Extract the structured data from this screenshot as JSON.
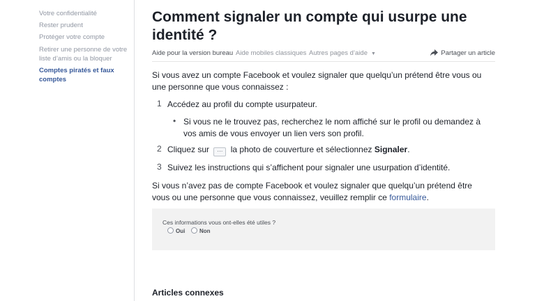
{
  "sidebar": {
    "items": [
      {
        "label": "Votre confidentialité",
        "active": false
      },
      {
        "label": "Rester prudent",
        "active": false
      },
      {
        "label": "Protéger votre compte",
        "active": false
      },
      {
        "label": "Retirer une personne de votre liste d’amis ou la bloquer",
        "active": false
      },
      {
        "label": "Comptes piratés et faux comptes",
        "active": true
      }
    ]
  },
  "article": {
    "title": "Comment signaler un compte qui usurpe une identité ?",
    "tabs": {
      "desktop": "Aide pour la version bureau",
      "mobile": "Aide mobiles classiques",
      "other": "Autres pages d’aide"
    },
    "share": "Partager un article",
    "intro": "Si vous avez un compte Facebook et voulez signaler que quelqu’un prétend être vous ou une personne que vous connaissez :",
    "steps": [
      {
        "num": "1",
        "text": "Accédez au profil du compte usurpateur."
      },
      {
        "num": "2",
        "before": "Cliquez sur",
        "button": "···",
        "after": "la photo de couverture et sélectionnez",
        "bold": "Signaler",
        "end": "."
      },
      {
        "num": "3",
        "text": "Suivez les instructions qui s’affichent pour signaler une usurpation d’identité."
      }
    ],
    "sub_bullet": "Si vous ne le trouvez pas, recherchez le nom affiché sur le profil ou demandez à vos amis de vous envoyer un lien vers son profil.",
    "no_account": {
      "text": "Si vous n’avez pas de compte Facebook et voulez signaler que quelqu’un prétend être vous ou une personne que vous connaissez, veuillez remplir ce",
      "link": "formulaire",
      "end": "."
    },
    "feedback": {
      "question": "Ces informations vous ont-elles été utiles ?",
      "yes": "Oui",
      "no": "Non"
    },
    "related": "Articles connexes"
  },
  "colors": {
    "link": "#365899",
    "sidebar_muted": "#9197a3",
    "feedback_bg": "#f2f2f2"
  }
}
